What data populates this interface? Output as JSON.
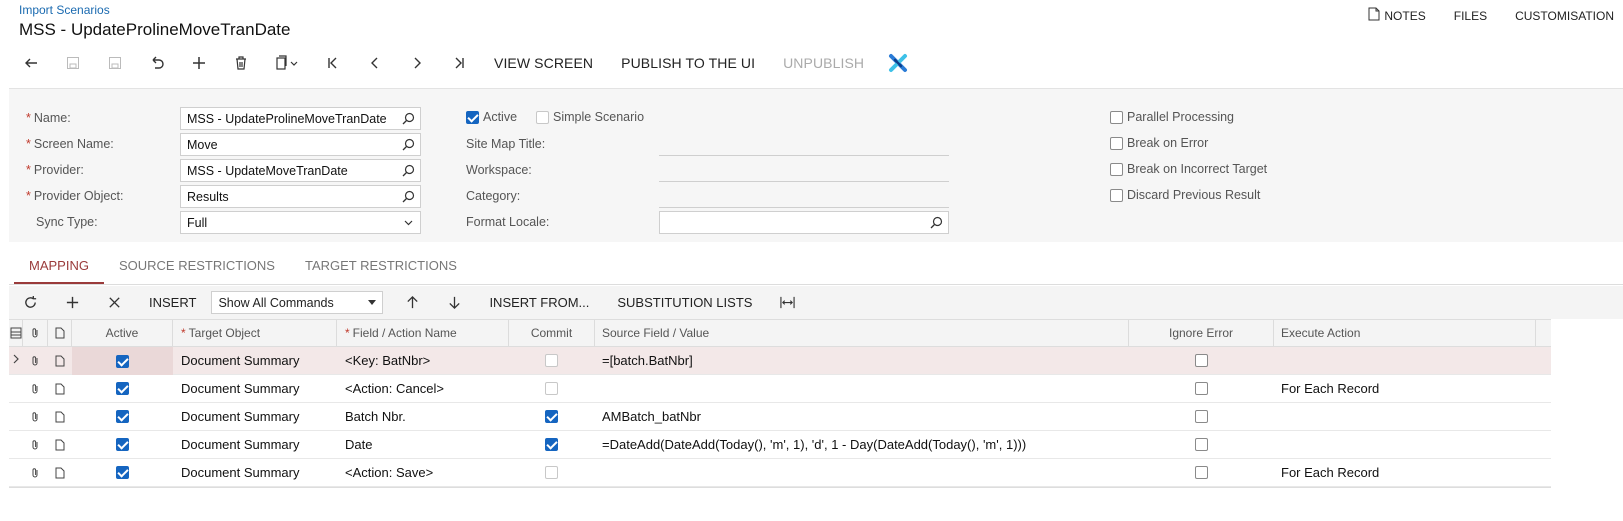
{
  "header": {
    "breadcrumb": "Import Scenarios",
    "title": "MSS - UpdateProlineMoveTranDate",
    "links": {
      "notes": "NOTES",
      "files": "FILES",
      "customisation": "CUSTOMISATION"
    }
  },
  "toolbar": {
    "view_screen": "VIEW SCREEN",
    "publish": "PUBLISH TO THE UI",
    "unpublish": "UNPUBLISH"
  },
  "form": {
    "name_label": "Name:",
    "name_value": "MSS - UpdateProlineMoveTranDate",
    "screen_label": "Screen Name:",
    "screen_value": "Move",
    "provider_label": "Provider:",
    "provider_value": "MSS - UpdateMoveTranDate",
    "provider_object_label": "Provider Object:",
    "provider_object_value": "Results",
    "sync_label": "Sync Type:",
    "sync_value": "Full",
    "active_label": "Active",
    "active_checked": true,
    "simple_label": "Simple Scenario",
    "simple_checked": false,
    "sitemap_label": "Site Map Title:",
    "workspace_label": "Workspace:",
    "category_label": "Category:",
    "locale_label": "Format Locale:",
    "parallel_label": "Parallel Processing",
    "break_error_label": "Break on Error",
    "break_target_label": "Break on Incorrect Target",
    "discard_label": "Discard Previous Result"
  },
  "tabs": [
    "MAPPING",
    "SOURCE RESTRICTIONS",
    "TARGET RESTRICTIONS"
  ],
  "grid_toolbar": {
    "insert": "INSERT",
    "filter_value": "Show All Commands",
    "insert_from": "INSERT FROM...",
    "substitution": "SUBSTITUTION LISTS"
  },
  "grid": {
    "headers": {
      "active": "Active",
      "target": "Target Object",
      "field": "Field / Action Name",
      "commit": "Commit",
      "source": "Source Field / Value",
      "ignore": "Ignore Error",
      "exec": "Execute Action"
    },
    "rows": [
      {
        "active": true,
        "target": "Document Summary",
        "field": "<Key: BatNbr>",
        "commit": false,
        "source": "=[batch.BatNbr]",
        "ignore": false,
        "exec": ""
      },
      {
        "active": true,
        "target": "Document Summary",
        "field": "<Action: Cancel>",
        "commit": false,
        "source": "",
        "ignore": false,
        "exec": "For Each Record"
      },
      {
        "active": true,
        "target": "Document Summary",
        "field": "Batch Nbr.",
        "commit": true,
        "source": "AMBatch_batNbr",
        "ignore": false,
        "exec": ""
      },
      {
        "active": true,
        "target": "Document Summary",
        "field": "Date",
        "commit": true,
        "source": "=DateAdd(DateAdd(Today(), 'm', 1), 'd', 1 - Day(DateAdd(Today(), 'm', 1)))",
        "ignore": false,
        "exec": ""
      },
      {
        "active": true,
        "target": "Document Summary",
        "field": "<Action: Save>",
        "commit": false,
        "source": "",
        "ignore": false,
        "exec": "For Each Record"
      }
    ]
  }
}
